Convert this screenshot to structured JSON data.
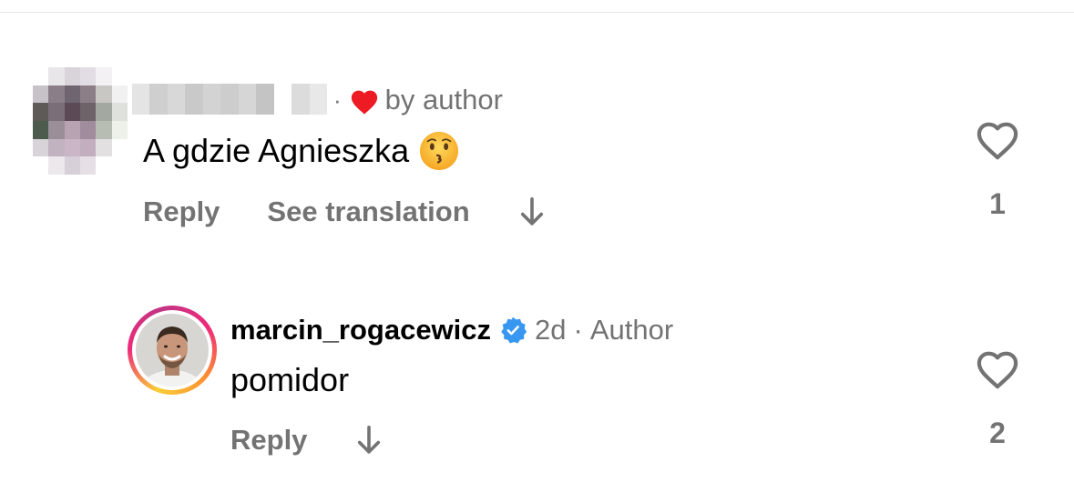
{
  "comment1": {
    "liked_by_label": "by author",
    "text": "A gdzie Agnieszka",
    "emoji": "kissing-face",
    "actions": {
      "reply": "Reply",
      "see_translation": "See translation"
    },
    "like_count": "1"
  },
  "comment2": {
    "username": "marcin_rogacewicz",
    "verified": true,
    "time": "2d",
    "separator": "·",
    "role": "Author",
    "text": "pomidor",
    "actions": {
      "reply": "Reply"
    },
    "like_count": "2"
  },
  "meta_separator": "·",
  "colors": {
    "secondary_text": "#737373",
    "heart_red": "#ed1c24",
    "verified_blue": "#3897f0"
  }
}
